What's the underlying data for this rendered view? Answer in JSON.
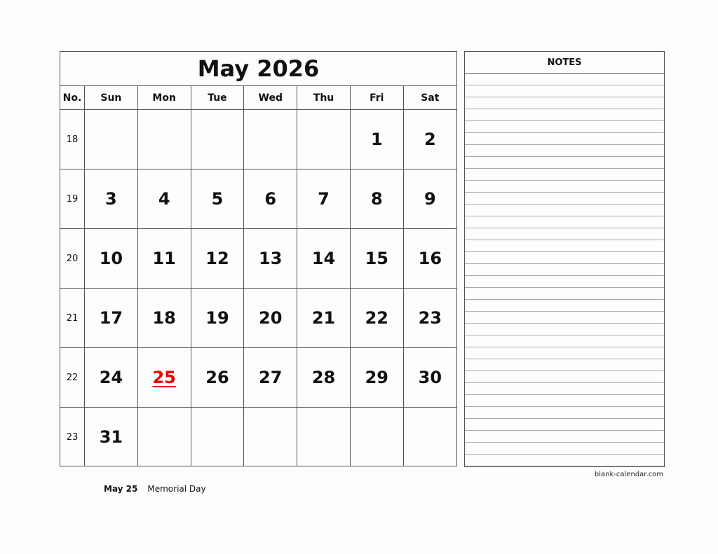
{
  "calendar": {
    "title": "May 2026",
    "headers": [
      "No.",
      "Sun",
      "Mon",
      "Tue",
      "Wed",
      "Thu",
      "Fri",
      "Sat"
    ],
    "weeks": [
      {
        "no": "18",
        "days": [
          "",
          "",
          "",
          "",
          "",
          "1",
          "2"
        ]
      },
      {
        "no": "19",
        "days": [
          "3",
          "4",
          "5",
          "6",
          "7",
          "8",
          "9"
        ]
      },
      {
        "no": "20",
        "days": [
          "10",
          "11",
          "12",
          "13",
          "14",
          "15",
          "16"
        ]
      },
      {
        "no": "21",
        "days": [
          "17",
          "18",
          "19",
          "20",
          "21",
          "22",
          "23"
        ]
      },
      {
        "no": "22",
        "days": [
          "24",
          "25",
          "26",
          "27",
          "28",
          "29",
          "30"
        ]
      },
      {
        "no": "23",
        "days": [
          "31",
          "",
          "",
          "",
          "",
          "",
          ""
        ]
      }
    ],
    "holiday_days": [
      "25"
    ],
    "holiday_color": "#e00000"
  },
  "notes": {
    "title": "NOTES"
  },
  "holidays": [
    {
      "date": "May 25",
      "name": "Memorial Day"
    }
  ],
  "credit": "blank-calendar.com"
}
